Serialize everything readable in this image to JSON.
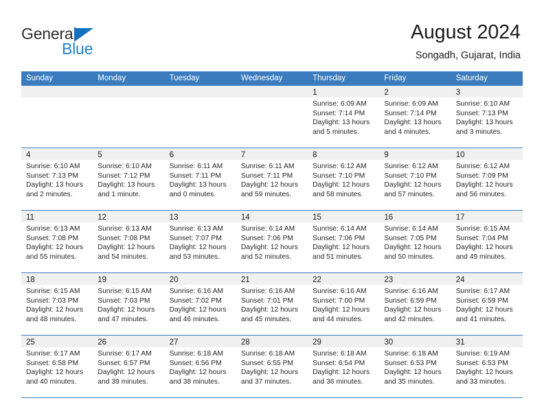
{
  "brand": {
    "line1": "General",
    "line2": "Blue",
    "triangle_icon": "triangle-icon",
    "accent_color": "#1f80d0"
  },
  "header": {
    "title": "August 2024",
    "subtitle": "Songadh, Gujarat, India"
  },
  "calendar": {
    "header_bg": "#3a7cbe",
    "day_bar_bg": "#f0f0f0",
    "weekdays": [
      "Sunday",
      "Monday",
      "Tuesday",
      "Wednesday",
      "Thursday",
      "Friday",
      "Saturday"
    ],
    "weeks": [
      [
        {
          "day": "",
          "empty": true,
          "sunrise": "",
          "sunset": "",
          "daylight1": "",
          "daylight2": ""
        },
        {
          "day": "",
          "empty": true,
          "sunrise": "",
          "sunset": "",
          "daylight1": "",
          "daylight2": ""
        },
        {
          "day": "",
          "empty": true,
          "sunrise": "",
          "sunset": "",
          "daylight1": "",
          "daylight2": ""
        },
        {
          "day": "",
          "empty": true,
          "sunrise": "",
          "sunset": "",
          "daylight1": "",
          "daylight2": ""
        },
        {
          "day": "1",
          "empty": false,
          "sunrise": "Sunrise: 6:09 AM",
          "sunset": "Sunset: 7:14 PM",
          "daylight1": "Daylight: 13 hours",
          "daylight2": "and 5 minutes."
        },
        {
          "day": "2",
          "empty": false,
          "sunrise": "Sunrise: 6:09 AM",
          "sunset": "Sunset: 7:14 PM",
          "daylight1": "Daylight: 13 hours",
          "daylight2": "and 4 minutes."
        },
        {
          "day": "3",
          "empty": false,
          "sunrise": "Sunrise: 6:10 AM",
          "sunset": "Sunset: 7:13 PM",
          "daylight1": "Daylight: 13 hours",
          "daylight2": "and 3 minutes."
        }
      ],
      [
        {
          "day": "4",
          "empty": false,
          "sunrise": "Sunrise: 6:10 AM",
          "sunset": "Sunset: 7:13 PM",
          "daylight1": "Daylight: 13 hours",
          "daylight2": "and 2 minutes."
        },
        {
          "day": "5",
          "empty": false,
          "sunrise": "Sunrise: 6:10 AM",
          "sunset": "Sunset: 7:12 PM",
          "daylight1": "Daylight: 13 hours",
          "daylight2": "and 1 minute."
        },
        {
          "day": "6",
          "empty": false,
          "sunrise": "Sunrise: 6:11 AM",
          "sunset": "Sunset: 7:11 PM",
          "daylight1": "Daylight: 13 hours",
          "daylight2": "and 0 minutes."
        },
        {
          "day": "7",
          "empty": false,
          "sunrise": "Sunrise: 6:11 AM",
          "sunset": "Sunset: 7:11 PM",
          "daylight1": "Daylight: 12 hours",
          "daylight2": "and 59 minutes."
        },
        {
          "day": "8",
          "empty": false,
          "sunrise": "Sunrise: 6:12 AM",
          "sunset": "Sunset: 7:10 PM",
          "daylight1": "Daylight: 12 hours",
          "daylight2": "and 58 minutes."
        },
        {
          "day": "9",
          "empty": false,
          "sunrise": "Sunrise: 6:12 AM",
          "sunset": "Sunset: 7:10 PM",
          "daylight1": "Daylight: 12 hours",
          "daylight2": "and 57 minutes."
        },
        {
          "day": "10",
          "empty": false,
          "sunrise": "Sunrise: 6:12 AM",
          "sunset": "Sunset: 7:09 PM",
          "daylight1": "Daylight: 12 hours",
          "daylight2": "and 56 minutes."
        }
      ],
      [
        {
          "day": "11",
          "empty": false,
          "sunrise": "Sunrise: 6:13 AM",
          "sunset": "Sunset: 7:08 PM",
          "daylight1": "Daylight: 12 hours",
          "daylight2": "and 55 minutes."
        },
        {
          "day": "12",
          "empty": false,
          "sunrise": "Sunrise: 6:13 AM",
          "sunset": "Sunset: 7:08 PM",
          "daylight1": "Daylight: 12 hours",
          "daylight2": "and 54 minutes."
        },
        {
          "day": "13",
          "empty": false,
          "sunrise": "Sunrise: 6:13 AM",
          "sunset": "Sunset: 7:07 PM",
          "daylight1": "Daylight: 12 hours",
          "daylight2": "and 53 minutes."
        },
        {
          "day": "14",
          "empty": false,
          "sunrise": "Sunrise: 6:14 AM",
          "sunset": "Sunset: 7:06 PM",
          "daylight1": "Daylight: 12 hours",
          "daylight2": "and 52 minutes."
        },
        {
          "day": "15",
          "empty": false,
          "sunrise": "Sunrise: 6:14 AM",
          "sunset": "Sunset: 7:06 PM",
          "daylight1": "Daylight: 12 hours",
          "daylight2": "and 51 minutes."
        },
        {
          "day": "16",
          "empty": false,
          "sunrise": "Sunrise: 6:14 AM",
          "sunset": "Sunset: 7:05 PM",
          "daylight1": "Daylight: 12 hours",
          "daylight2": "and 50 minutes."
        },
        {
          "day": "17",
          "empty": false,
          "sunrise": "Sunrise: 6:15 AM",
          "sunset": "Sunset: 7:04 PM",
          "daylight1": "Daylight: 12 hours",
          "daylight2": "and 49 minutes."
        }
      ],
      [
        {
          "day": "18",
          "empty": false,
          "sunrise": "Sunrise: 6:15 AM",
          "sunset": "Sunset: 7:03 PM",
          "daylight1": "Daylight: 12 hours",
          "daylight2": "and 48 minutes."
        },
        {
          "day": "19",
          "empty": false,
          "sunrise": "Sunrise: 6:15 AM",
          "sunset": "Sunset: 7:03 PM",
          "daylight1": "Daylight: 12 hours",
          "daylight2": "and 47 minutes."
        },
        {
          "day": "20",
          "empty": false,
          "sunrise": "Sunrise: 6:16 AM",
          "sunset": "Sunset: 7:02 PM",
          "daylight1": "Daylight: 12 hours",
          "daylight2": "and 46 minutes."
        },
        {
          "day": "21",
          "empty": false,
          "sunrise": "Sunrise: 6:16 AM",
          "sunset": "Sunset: 7:01 PM",
          "daylight1": "Daylight: 12 hours",
          "daylight2": "and 45 minutes."
        },
        {
          "day": "22",
          "empty": false,
          "sunrise": "Sunrise: 6:16 AM",
          "sunset": "Sunset: 7:00 PM",
          "daylight1": "Daylight: 12 hours",
          "daylight2": "and 44 minutes."
        },
        {
          "day": "23",
          "empty": false,
          "sunrise": "Sunrise: 6:16 AM",
          "sunset": "Sunset: 6:59 PM",
          "daylight1": "Daylight: 12 hours",
          "daylight2": "and 42 minutes."
        },
        {
          "day": "24",
          "empty": false,
          "sunrise": "Sunrise: 6:17 AM",
          "sunset": "Sunset: 6:59 PM",
          "daylight1": "Daylight: 12 hours",
          "daylight2": "and 41 minutes."
        }
      ],
      [
        {
          "day": "25",
          "empty": false,
          "sunrise": "Sunrise: 6:17 AM",
          "sunset": "Sunset: 6:58 PM",
          "daylight1": "Daylight: 12 hours",
          "daylight2": "and 40 minutes."
        },
        {
          "day": "26",
          "empty": false,
          "sunrise": "Sunrise: 6:17 AM",
          "sunset": "Sunset: 6:57 PM",
          "daylight1": "Daylight: 12 hours",
          "daylight2": "and 39 minutes."
        },
        {
          "day": "27",
          "empty": false,
          "sunrise": "Sunrise: 6:18 AM",
          "sunset": "Sunset: 6:56 PM",
          "daylight1": "Daylight: 12 hours",
          "daylight2": "and 38 minutes."
        },
        {
          "day": "28",
          "empty": false,
          "sunrise": "Sunrise: 6:18 AM",
          "sunset": "Sunset: 6:55 PM",
          "daylight1": "Daylight: 12 hours",
          "daylight2": "and 37 minutes."
        },
        {
          "day": "29",
          "empty": false,
          "sunrise": "Sunrise: 6:18 AM",
          "sunset": "Sunset: 6:54 PM",
          "daylight1": "Daylight: 12 hours",
          "daylight2": "and 36 minutes."
        },
        {
          "day": "30",
          "empty": false,
          "sunrise": "Sunrise: 6:18 AM",
          "sunset": "Sunset: 6:53 PM",
          "daylight1": "Daylight: 12 hours",
          "daylight2": "and 35 minutes."
        },
        {
          "day": "31",
          "empty": false,
          "sunrise": "Sunrise: 6:19 AM",
          "sunset": "Sunset: 6:53 PM",
          "daylight1": "Daylight: 12 hours",
          "daylight2": "and 33 minutes."
        }
      ]
    ]
  }
}
